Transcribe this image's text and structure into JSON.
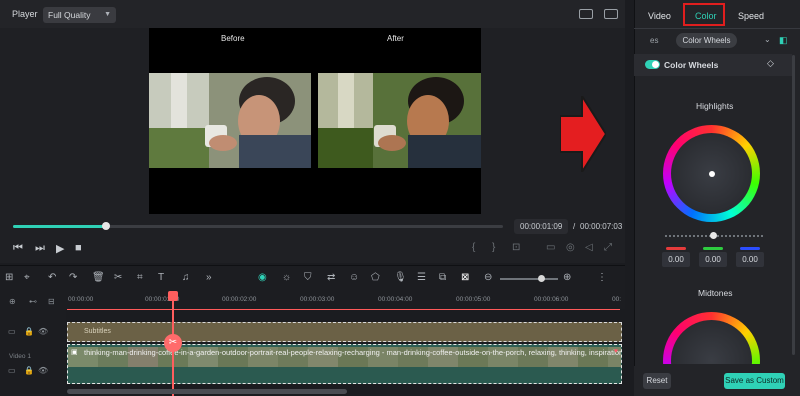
{
  "player": {
    "label": "Player",
    "quality": "Full Quality",
    "before_label": "Before",
    "after_label": "After",
    "progress_fraction": 0.19,
    "current_time": "00:00:01:09",
    "separator": "/",
    "total_time": "00:00:07:03"
  },
  "panel": {
    "tabs": [
      "Video",
      "Color",
      "Speed"
    ],
    "active_tab": "Color",
    "subtab_left": "es",
    "subtab_active": "Color Wheels",
    "section_title": "Color Wheels",
    "highlights_label": "Highlights",
    "rgb_values": [
      "0.00",
      "0.00",
      "0.00"
    ],
    "midtones_label": "Midtones",
    "reset_label": "Reset",
    "save_label": "Save as Custom",
    "colors": {
      "red": "#e53b3b",
      "green": "#2ecc40",
      "blue": "#2b4dff",
      "accent": "#2fd1b6"
    }
  },
  "timeline": {
    "ruler_ticks": [
      "00:00:00",
      "00:00:01:00",
      "00:00:02:00",
      "00:00:03:00",
      "00:00:04:00",
      "00:00:05:00",
      "00:00:06:00",
      "00:"
    ],
    "subtitles_label": "Subtitles",
    "video_track_label": "Video 1",
    "clip_label": "thinking-man-drinking-coffee-in-a-garden-outdoor-portrait-real-people-relaxing-recharging - man-drinking-coffee-outside-on-the-porch, relaxing, thinking, inspiration"
  }
}
